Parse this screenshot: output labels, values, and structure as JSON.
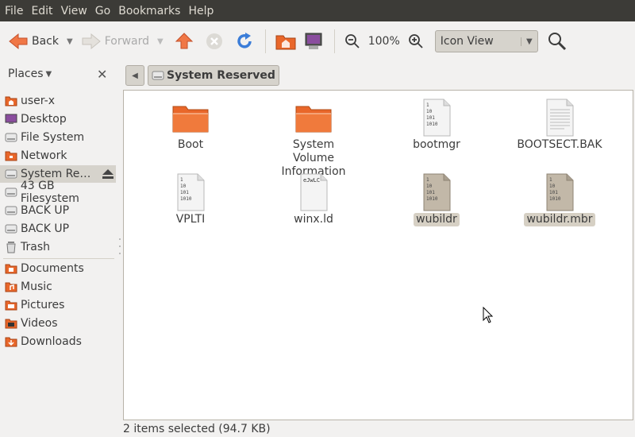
{
  "menubar": {
    "items": [
      "File",
      "Edit",
      "View",
      "Go",
      "Bookmarks",
      "Help"
    ]
  },
  "toolbar": {
    "back_label": "Back",
    "forward_label": "Forward",
    "zoom_level": "100%",
    "view_select": "Icon View"
  },
  "location": {
    "current": "System Reserved"
  },
  "sidebar": {
    "header": "Places",
    "items": [
      {
        "label": "user-x",
        "icon": "home-folder-icon"
      },
      {
        "label": "Desktop",
        "icon": "desktop-icon"
      },
      {
        "label": "File System",
        "icon": "drive-icon"
      },
      {
        "label": "Network",
        "icon": "network-icon"
      },
      {
        "label": "System Re…",
        "icon": "drive-icon",
        "selected": true,
        "ejectable": true
      },
      {
        "label": "43 GB Filesystem",
        "icon": "drive-icon"
      },
      {
        "label": "BACK UP",
        "icon": "drive-icon"
      },
      {
        "label": "BACK UP",
        "icon": "drive-icon"
      },
      {
        "label": "Trash",
        "icon": "trash-icon"
      },
      {
        "label": "Documents",
        "icon": "folder-icon"
      },
      {
        "label": "Music",
        "icon": "music-folder-icon"
      },
      {
        "label": "Pictures",
        "icon": "pictures-folder-icon"
      },
      {
        "label": "Videos",
        "icon": "videos-folder-icon"
      },
      {
        "label": "Downloads",
        "icon": "downloads-folder-icon"
      }
    ]
  },
  "files": [
    {
      "name": "Boot",
      "type": "folder"
    },
    {
      "name": "System Volume Information",
      "type": "folder"
    },
    {
      "name": "bootmgr",
      "type": "binary"
    },
    {
      "name": "BOOTSECT.BAK",
      "type": "text"
    },
    {
      "name": "VPLTI",
      "type": "binary"
    },
    {
      "name": "winx.ld",
      "type": "binary",
      "preview": "eJwLC"
    },
    {
      "name": "wubildr",
      "type": "binary",
      "selected": true
    },
    {
      "name": "wubildr.mbr",
      "type": "binary",
      "selected": true
    }
  ],
  "binary_glyph_lines": [
    "1",
    "10",
    "101",
    "1010"
  ],
  "status": {
    "text": "2 items selected (94.7 KB)"
  },
  "colors": {
    "menubar_bg": "#3c3b37",
    "folder_orange": "#e9672a",
    "selection": "#d6d0c4"
  }
}
